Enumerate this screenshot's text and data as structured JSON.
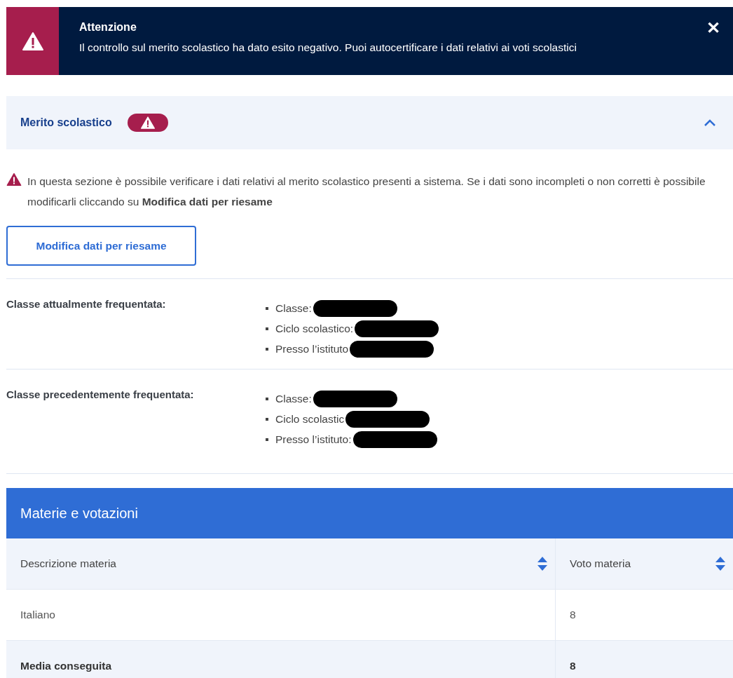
{
  "alert": {
    "title": "Attenzione",
    "message": "Il controllo sul merito scolastico ha dato esito negativo. Puoi autocertificare i dati relativi ai voti scolastici",
    "close": "✕"
  },
  "accordion": {
    "title": "Merito scolastico",
    "expanded": true,
    "info": "In questa sezione è possibile verificare i dati relativi al merito scolastico presenti a sistema. Se i dati sono incompleti o non corretti è possibile modificarli cliccando su **Modifica dati per riesame**",
    "button": "Modifica dati per riesame",
    "sections": [
      {
        "label": "Classe attualmente frequentata:",
        "items": [
          "Classe:",
          "Ciclo scolastico:",
          "Presso l’istituto"
        ]
      },
      {
        "label": "Classe precedentemente frequentata:",
        "items": [
          "Classe:",
          "Ciclo scolastic",
          "Presso l’istituto:"
        ]
      }
    ],
    "table": {
      "title": "Materie e votazioni",
      "columns": [
        "Descrizione materia",
        "Voto materia"
      ],
      "rows": [
        {
          "kind": "plain",
          "cells": [
            "Italiano",
            "8"
          ]
        },
        {
          "kind": "summary",
          "cells": [
            "Media conseguita",
            "8"
          ]
        }
      ]
    }
  }
}
